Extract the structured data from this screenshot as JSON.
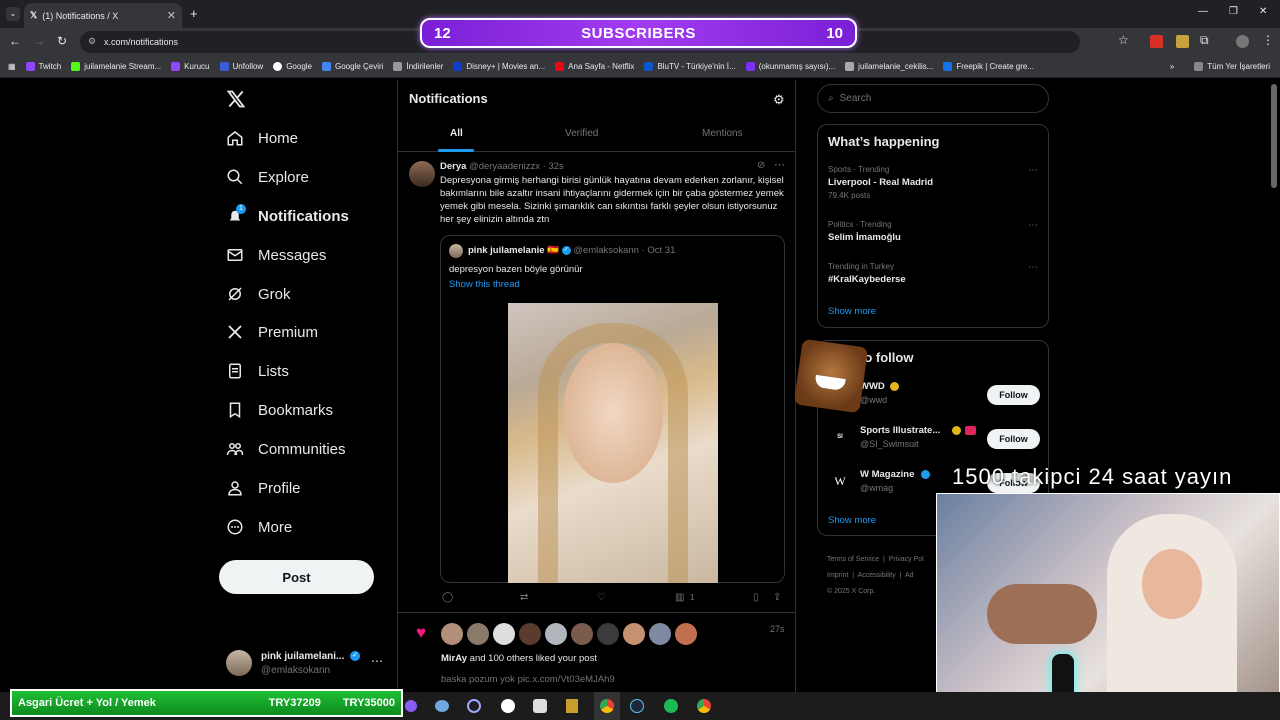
{
  "browser": {
    "tab_title": "(1) Notifications / X",
    "url": "x.com/notifications",
    "bookmarks": [
      "Twitch",
      "juilamelanie Stream...",
      "Kurucu",
      "Unfollow",
      "Google",
      "Google Çeviri",
      "İndirilenler",
      "Disney+ | Movies an...",
      "Ana Sayfa - Netflix",
      "BluTV - Türkiye'nin İ...",
      "(okunmamış sayısı)...",
      "juilamelanie_cekilis...",
      "Freepik | Create gre..."
    ],
    "all_bookmarks": "Tüm Yer İşaretleri"
  },
  "overlay": {
    "sub_left": "12",
    "sub_label": "SUBSCRIBERS",
    "sub_right": "10",
    "cam_caption": "1500 takipci 24 saat yayın",
    "ticker_label": "Asgari Ücret + Yol / Yemek",
    "ticker_value1": "TRY37209",
    "ticker_value2": "TRY35000"
  },
  "nav": {
    "items": [
      "Home",
      "Explore",
      "Notifications",
      "Messages",
      "Grok",
      "Premium",
      "Lists",
      "Bookmarks",
      "Communities",
      "Profile",
      "More"
    ],
    "post_label": "Post",
    "notif_badge": "1",
    "account_name": "pink juilamelani...",
    "account_handle": "@emlaksokann"
  },
  "center": {
    "title": "Notifications",
    "tabs": [
      "All",
      "Verified",
      "Mentions"
    ],
    "tweet": {
      "name": "Derya",
      "handle": "@deryaadenizzx",
      "time": "· 32s",
      "text": "Depresyona girmiş herhangi birisi günlük hayatına devam ederken zorlanır, kişisel bakımlarını bile azaltır insani ihtiyaçlarını gidermek için bir çaba göstermez yemek yemek gibi mesela. Sizinki şımarıklık can sıkıntısı farklı şeyler olsun istiyorsunuz her şey elinizin altında ztn",
      "quote": {
        "name": "pink juilamelanie 🇪🇸",
        "handle": "@emlaksokann",
        "date": "· Oct 31",
        "text": "depresyon bazen böyle görünür",
        "show_thread": "Show this thread"
      },
      "views": "1"
    },
    "like_notif": {
      "time": "27s",
      "text_bold": "MirAy",
      "text_rest": " and 100 others liked your post",
      "post_text": "baska pozum yok pic.x.com/Vt03eMJAh9"
    }
  },
  "right": {
    "search_placeholder": "Search",
    "happening_title": "What’s happening",
    "trends": [
      {
        "meta": "Sports · Trending",
        "title": "Liverpool - Real Madrid",
        "count": "79.4K posts"
      },
      {
        "meta": "Politics · Trending",
        "title": "Selim İmamoğlu",
        "count": ""
      },
      {
        "meta": "Trending in Turkey",
        "title": "#KralKaybederse",
        "count": ""
      }
    ],
    "show_more": "Show more",
    "who_title": "to follow",
    "who": [
      {
        "name": "WWD",
        "handle": "@wwd"
      },
      {
        "name": "Sports Illustrate...",
        "handle": "@SI_Swimsuit"
      },
      {
        "name": "W Magazine",
        "handle": "@wmag"
      }
    ],
    "follow_label": "Follow",
    "footer": [
      "Terms of Service",
      "Privacy Pol",
      "Imprint",
      "Accessibility",
      "Ad"
    ],
    "copyright": "© 2025 X Corp."
  },
  "colors": {
    "accent": "#1d9bf0",
    "banner": "#a23cf0",
    "ticker": "#1fbf34",
    "like": "#f91880"
  }
}
